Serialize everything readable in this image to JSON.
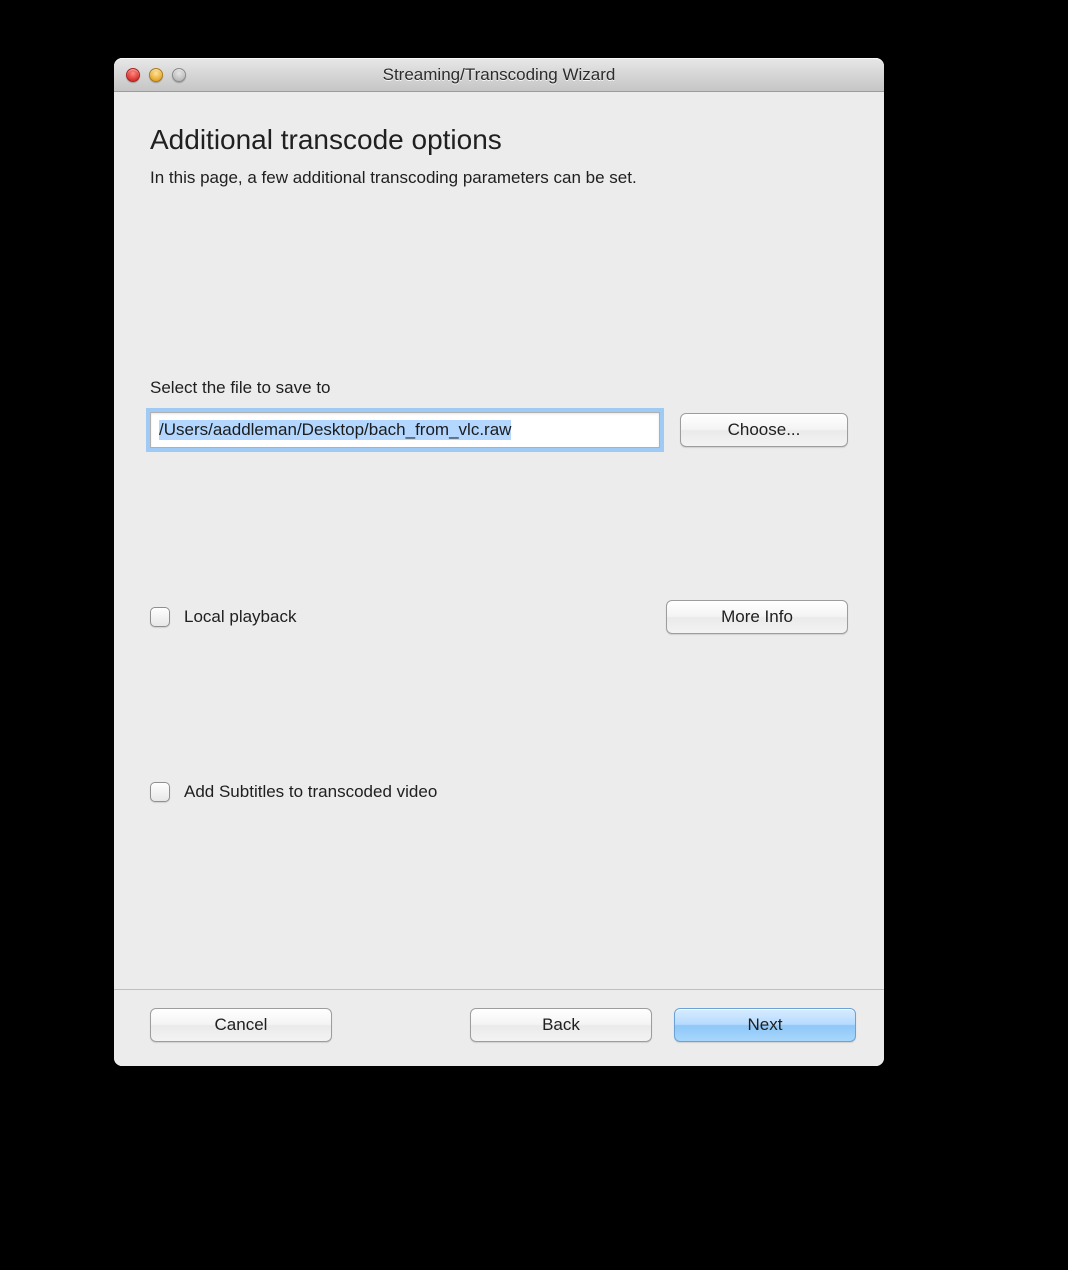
{
  "window": {
    "title": "Streaming/Transcoding Wizard"
  },
  "page": {
    "heading": "Additional transcode options",
    "subtitle": "In this page, a few additional transcoding parameters can be set."
  },
  "file_section": {
    "label": "Select the file to save to",
    "path_value": "/Users/aaddleman/Desktop/bach_from_vlc.raw",
    "choose_label": "Choose..."
  },
  "local_playback": {
    "label": "Local playback",
    "checked": false,
    "more_info_label": "More Info"
  },
  "subtitles": {
    "label": "Add Subtitles to transcoded video",
    "checked": false
  },
  "footer": {
    "cancel_label": "Cancel",
    "back_label": "Back",
    "next_label": "Next"
  }
}
